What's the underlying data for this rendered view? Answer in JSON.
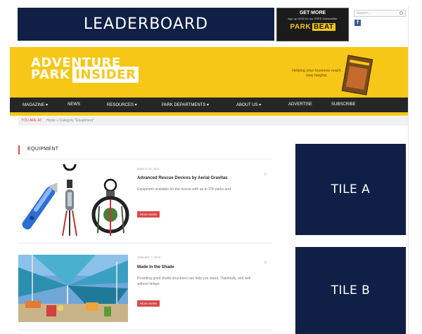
{
  "ads": {
    "leaderboard": "LEADERBOARD",
    "promo_line1": "GET MORE",
    "promo_line2": "sign up NOW for our FREE eNewsletter",
    "promo_brand": "PARK",
    "promo_brand2": "BEAT",
    "tile_a": "TILE A",
    "tile_b": "TILE B"
  },
  "header": {
    "search_placeholder": "Search...",
    "facebook": "f",
    "logo_line1": "ADVENTURE",
    "logo_line2": "PARK",
    "logo_line3": "INSIDER",
    "tagline": "Helping your business reach new heights"
  },
  "nav": {
    "items": [
      "MAGAZINE ▾",
      "NEWS",
      "RESOURCES ▾",
      "PARK DEPARTMENTS ▾",
      "ABOUT US ▾",
      "ADVERTISE",
      "SUBSCRIBE"
    ]
  },
  "breadcrumb": {
    "you_are_here": "YOU ARE AT:",
    "home": "Home",
    "sep": "»",
    "current": "Category \"Equipment\""
  },
  "section": {
    "title": "EQUIPMENT"
  },
  "posts": [
    {
      "date": "MARCH 15, 2022",
      "title": "Advanced Rescue Devices by Aerial Gravitas",
      "excerpt": "Equipment available for the rescue with up to 100 parks and",
      "read_more": "READ MORE",
      "comments": "0"
    },
    {
      "date": "JANUARY 7, 2022",
      "title": "Made in the Shade",
      "excerpt": "Providing good shade structures can help you stand, Thankfully, and well without delays.",
      "read_more": "READ MORE",
      "comments": "0"
    }
  ],
  "colors": {
    "brand_yellow": "#f6c716",
    "navy": "#0f1f45",
    "accent_red": "#d84a4a",
    "nav_dark": "#262626"
  }
}
